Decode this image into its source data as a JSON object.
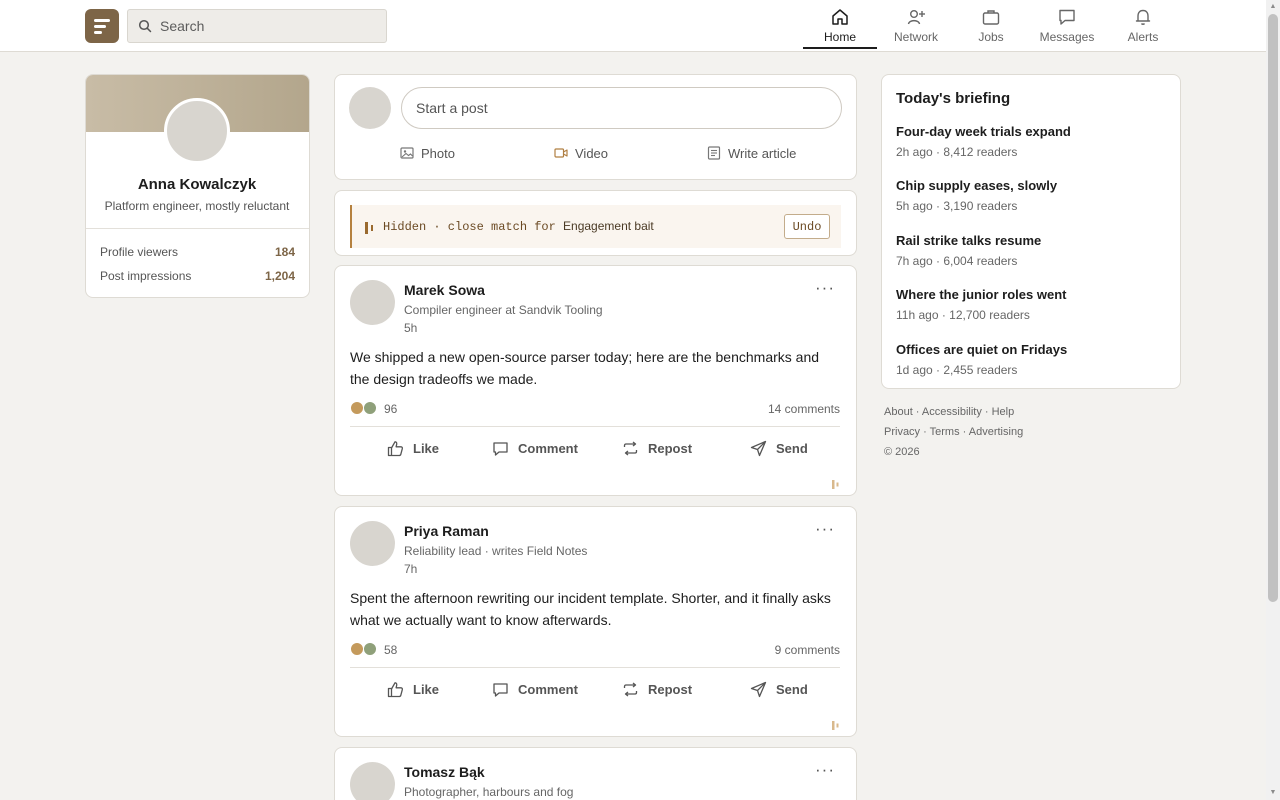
{
  "app": {
    "logo": "logo"
  },
  "search": {
    "placeholder": "Search"
  },
  "nav": {
    "items": [
      {
        "label": "Home",
        "icon": "home-icon",
        "active": true
      },
      {
        "label": "Network",
        "icon": "network-icon",
        "active": false
      },
      {
        "label": "Jobs",
        "icon": "briefcase-icon",
        "active": false
      },
      {
        "label": "Messages",
        "icon": "message-icon",
        "active": false
      },
      {
        "label": "Alerts",
        "icon": "bell-icon",
        "active": false
      }
    ]
  },
  "profile": {
    "name": "Anna Kowalczyk",
    "headline": "Platform engineer, mostly reluctant",
    "stats": [
      {
        "label": "Profile viewers",
        "value": "184"
      },
      {
        "label": "Post impressions",
        "value": "1,204"
      }
    ]
  },
  "composer": {
    "placeholder": "Start a post",
    "actions": [
      {
        "label": "Photo",
        "icon": "photo-icon"
      },
      {
        "label": "Video",
        "icon": "video-icon"
      },
      {
        "label": "Write article",
        "icon": "article-icon"
      }
    ]
  },
  "hidden_notice": {
    "prefix": "Hidden · close match for",
    "category": "Engagement bait",
    "undo_label": "Undo"
  },
  "posts": [
    {
      "author": "Marek Sowa",
      "subtitle": "Compiler engineer at Sandvik Tooling",
      "time": "5h",
      "body": "We shipped a new open-source parser today; here are the benchmarks and the design tradeoffs we made.",
      "reactions": "96",
      "comments": "14 comments"
    },
    {
      "author": "Priya Raman",
      "subtitle": "Reliability lead · writes Field Notes",
      "time": "7h",
      "body": "Spent the afternoon rewriting our incident template. Shorter, and it finally asks what we actually want to know afterwards.",
      "reactions": "58",
      "comments": "9 comments"
    },
    {
      "author": "Tomasz Bąk",
      "subtitle": "Photographer, harbours and fog"
    }
  ],
  "post_actions": {
    "like": "Like",
    "comment": "Comment",
    "repost": "Repost",
    "send": "Send",
    "more": "···"
  },
  "briefing": {
    "title": "Today's briefing",
    "items": [
      {
        "headline": "Four-day week trials expand",
        "meta": "2h ago · 8,412 readers"
      },
      {
        "headline": "Chip supply eases, slowly",
        "meta": "5h ago · 3,190 readers"
      },
      {
        "headline": "Rail strike talks resume",
        "meta": "7h ago · 6,004 readers"
      },
      {
        "headline": "Where the junior roles went",
        "meta": "11h ago · 12,700 readers"
      },
      {
        "headline": "Offices are quiet on Fridays",
        "meta": "1d ago · 2,455 readers"
      }
    ]
  },
  "footer": {
    "links_row1": [
      "About",
      "Accessibility",
      "Help"
    ],
    "links_row2": [
      "Privacy",
      "Terms",
      "Advertising"
    ],
    "copyright": "© 2026"
  },
  "colors": {
    "accent": "#7d6547",
    "hidden_accent": "#b5813f",
    "reaction_a": "#c49a5c",
    "reaction_b": "#8fa07a"
  }
}
